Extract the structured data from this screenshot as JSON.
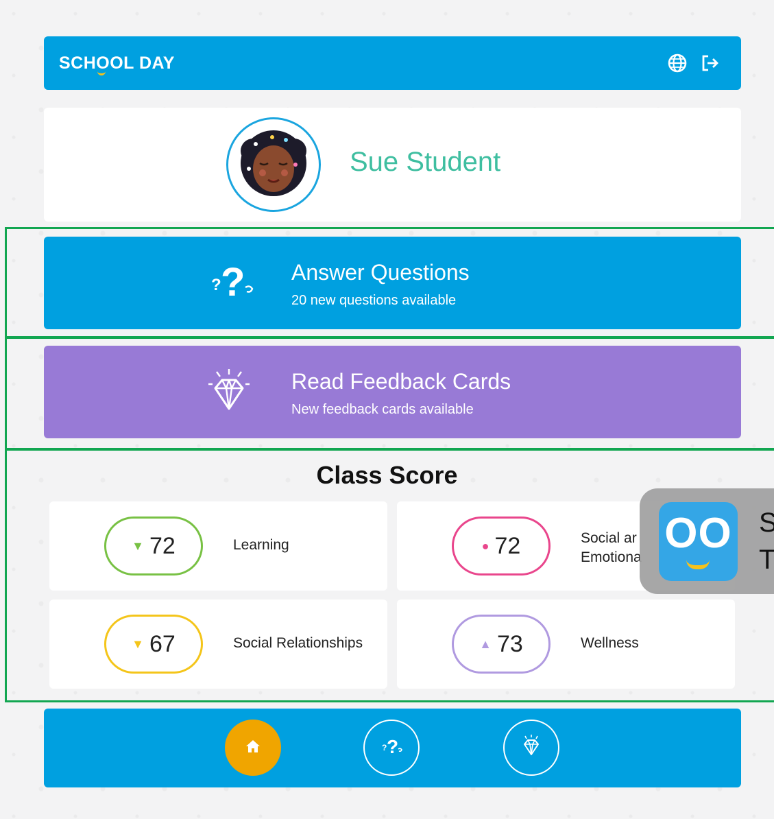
{
  "app": {
    "brand": "SCHOOL DAY",
    "accent": "#00a0e0",
    "feedback_color": "#987ad6"
  },
  "header": {
    "icons": [
      "globe-icon",
      "logout-icon"
    ]
  },
  "profile": {
    "name": "Sue Student"
  },
  "actions": {
    "answer": {
      "title": "Answer Questions",
      "subtitle": "20 new questions available",
      "icon": "question-icon"
    },
    "feedback": {
      "title": "Read Feedback Cards",
      "subtitle": "New feedback cards available",
      "icon": "diamond-icon"
    }
  },
  "class_score": {
    "title": "Class Score",
    "items": [
      {
        "value": "72",
        "label": "Learning",
        "marker": "▼",
        "color": "#78c144"
      },
      {
        "value": "72",
        "label": "Social and Emotional",
        "label_visible_line1": "Social ar",
        "label_visible_line2": "Emotiona",
        "marker": "●",
        "color": "#e9468c"
      },
      {
        "value": "67",
        "label": "Social Relationships",
        "marker": "▼",
        "color": "#f4c51a"
      },
      {
        "value": "73",
        "label": "Wellness",
        "marker": "▲",
        "color": "#b09ae0"
      }
    ]
  },
  "bottom_nav": {
    "items": [
      "home-icon",
      "question-icon",
      "diamond-icon"
    ],
    "active": "home",
    "active_color": "#f0a500"
  },
  "overlay": {
    "logo_text": "OO",
    "line1": "S",
    "line2": "T"
  }
}
